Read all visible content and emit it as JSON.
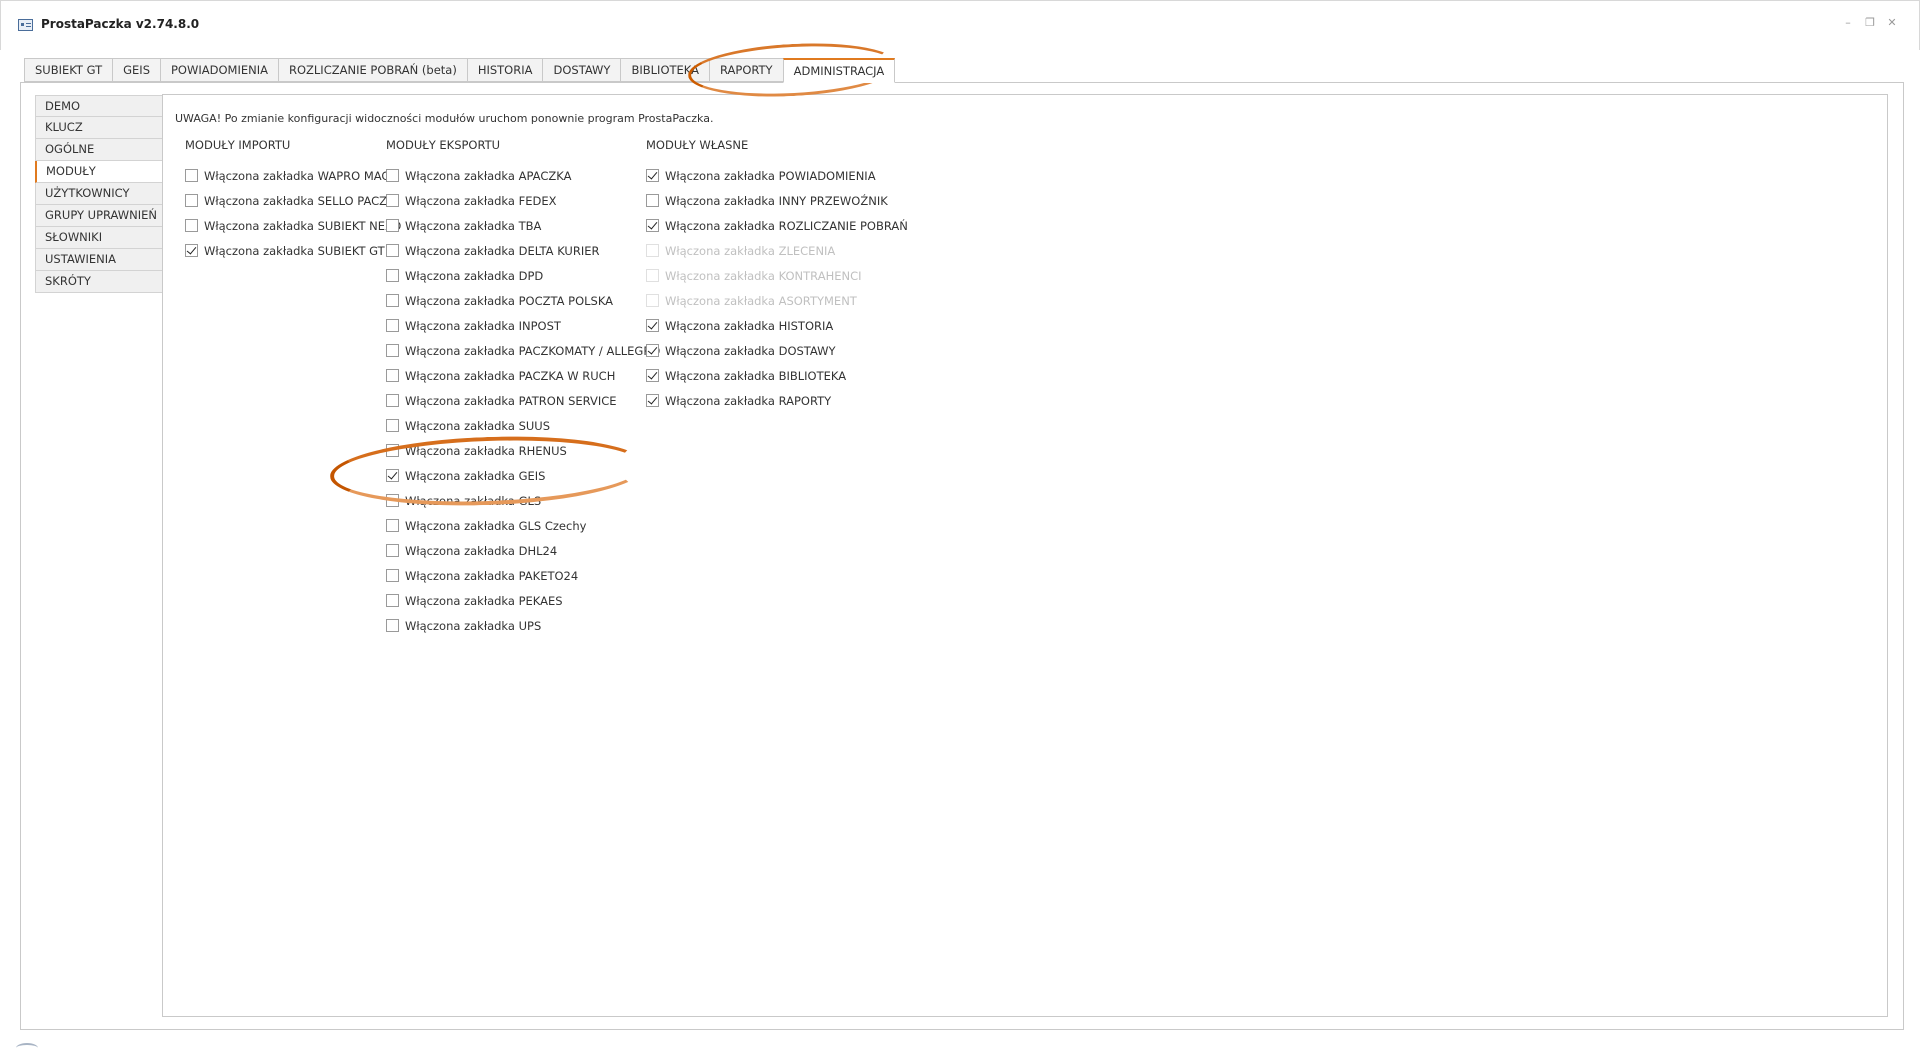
{
  "window": {
    "title": "ProstaPaczka v2.74.8.0",
    "controls": {
      "minimize": "–",
      "restore": "❐",
      "close": "✕"
    }
  },
  "tabs": [
    {
      "label": "SUBIEKT GT",
      "active": false
    },
    {
      "label": "GEIS",
      "active": false
    },
    {
      "label": "POWIADOMIENIA",
      "active": false
    },
    {
      "label": "ROZLICZANIE POBRAŃ (beta)",
      "active": false
    },
    {
      "label": "HISTORIA",
      "active": false
    },
    {
      "label": "DOSTAWY",
      "active": false
    },
    {
      "label": "BIBLIOTEKA",
      "active": false
    },
    {
      "label": "RAPORTY",
      "active": false
    },
    {
      "label": "ADMINISTRACJA",
      "active": true
    }
  ],
  "sidenav": [
    {
      "label": "DEMO",
      "active": false
    },
    {
      "label": "KLUCZ",
      "active": false
    },
    {
      "label": "OGÓLNE",
      "active": false
    },
    {
      "label": "MODUŁY",
      "active": true
    },
    {
      "label": "UŻYTKOWNICY",
      "active": false
    },
    {
      "label": "GRUPY UPRAWNIEŃ",
      "active": false
    },
    {
      "label": "SŁOWNIKI",
      "active": false
    },
    {
      "label": "USTAWIENIA",
      "active": false
    },
    {
      "label": "SKRÓTY",
      "active": false
    }
  ],
  "warning": "UWAGA! Po zmianie konfiguracji widoczności modułów uruchom ponownie program ProstaPaczka.",
  "columns": {
    "import": {
      "header": "MODUŁY IMPORTU",
      "items": [
        {
          "label": "Włączona zakładka WAPRO MAG",
          "checked": false,
          "disabled": false
        },
        {
          "label": "Włączona zakładka SELLO PACZKI",
          "checked": false,
          "disabled": false
        },
        {
          "label": "Włączona zakładka SUBIEKT NEXO",
          "checked": false,
          "disabled": false
        },
        {
          "label": "Włączona zakładka SUBIEKT GT",
          "checked": true,
          "disabled": false
        }
      ]
    },
    "export": {
      "header": "MODUŁY EKSPORTU",
      "items": [
        {
          "label": "Włączona zakładka APACZKA",
          "checked": false,
          "disabled": false
        },
        {
          "label": "Włączona zakładka FEDEX",
          "checked": false,
          "disabled": false
        },
        {
          "label": "Włączona zakładka TBA",
          "checked": false,
          "disabled": false
        },
        {
          "label": "Włączona zakładka DELTA KURIER",
          "checked": false,
          "disabled": false
        },
        {
          "label": "Włączona zakładka DPD",
          "checked": false,
          "disabled": false
        },
        {
          "label": "Włączona zakładka POCZTA POLSKA",
          "checked": false,
          "disabled": false
        },
        {
          "label": "Włączona zakładka INPOST",
          "checked": false,
          "disabled": false
        },
        {
          "label": "Włączona zakładka PACZKOMATY / ALLEGRO",
          "checked": false,
          "disabled": false
        },
        {
          "label": "Włączona zakładka PACZKA W RUCH",
          "checked": false,
          "disabled": false
        },
        {
          "label": "Włączona zakładka PATRON SERVICE",
          "checked": false,
          "disabled": false
        },
        {
          "label": "Włączona zakładka SUUS",
          "checked": false,
          "disabled": false
        },
        {
          "label": "Włączona zakładka RHENUS",
          "checked": false,
          "disabled": false
        },
        {
          "label": "Włączona zakładka GEIS",
          "checked": true,
          "disabled": false
        },
        {
          "label": "Włączona zakładka GLS",
          "checked": false,
          "disabled": false
        },
        {
          "label": "Włączona zakładka GLS Czechy",
          "checked": false,
          "disabled": false
        },
        {
          "label": "Włączona zakładka DHL24",
          "checked": false,
          "disabled": false
        },
        {
          "label": "Włączona zakładka PAKETO24",
          "checked": false,
          "disabled": false
        },
        {
          "label": "Włączona zakładka PEKAES",
          "checked": false,
          "disabled": false
        },
        {
          "label": "Włączona zakładka UPS",
          "checked": false,
          "disabled": false
        }
      ]
    },
    "own": {
      "header": "MODUŁY WŁASNE",
      "items": [
        {
          "label": "Włączona zakładka POWIADOMIENIA",
          "checked": true,
          "disabled": false
        },
        {
          "label": "Włączona zakładka INNY PRZEWOŹNIK",
          "checked": false,
          "disabled": false
        },
        {
          "label": "Włączona zakładka ROZLICZANIE POBRAŃ",
          "checked": true,
          "disabled": false
        },
        {
          "label": "Włączona zakładka ZLECENIA",
          "checked": false,
          "disabled": true
        },
        {
          "label": "Włączona zakładka KONTRAHENCI",
          "checked": false,
          "disabled": true
        },
        {
          "label": "Włączona zakładka ASORTYMENT",
          "checked": false,
          "disabled": true
        },
        {
          "label": "Włączona zakładka HISTORIA",
          "checked": true,
          "disabled": false
        },
        {
          "label": "Włączona zakładka DOSTAWY",
          "checked": true,
          "disabled": false
        },
        {
          "label": "Włączona zakładka BIBLIOTEKA",
          "checked": true,
          "disabled": false
        },
        {
          "label": "Włączona zakładka RAPORTY",
          "checked": true,
          "disabled": false
        }
      ]
    }
  },
  "colors": {
    "accent": "#e07a1f",
    "highlight_ring": "#cc5c00"
  }
}
